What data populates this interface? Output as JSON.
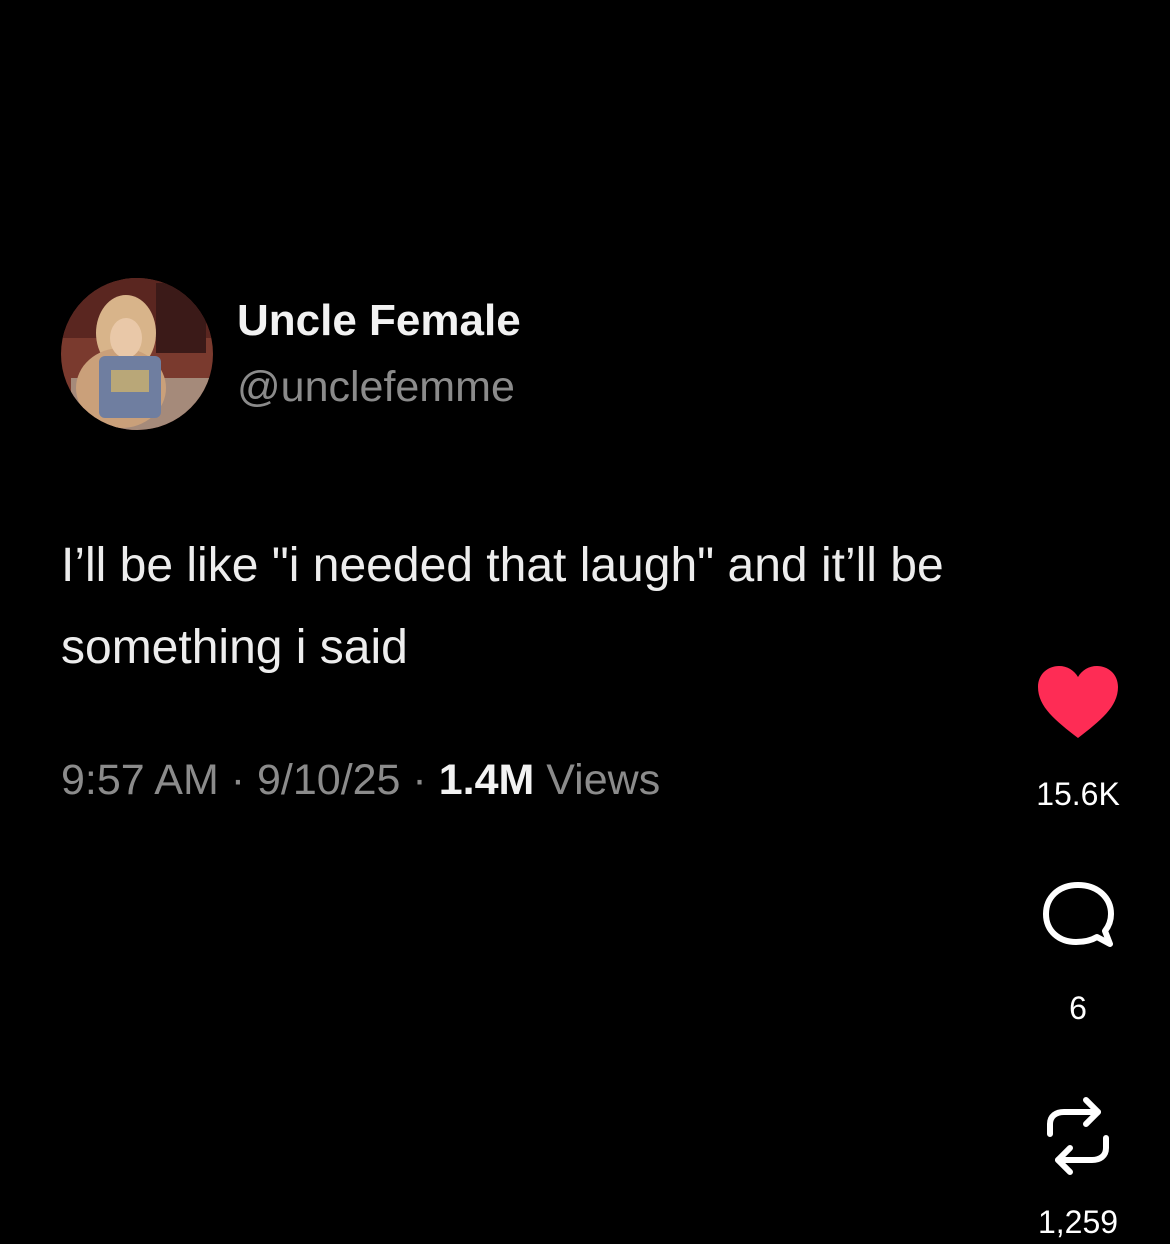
{
  "tweet": {
    "display_name": "Uncle Female",
    "handle": "@unclefemme",
    "text": "I’ll be like \"i needed that laugh\" and it’ll be something i said",
    "time": "9:57 AM",
    "separator": "·",
    "date": "9/10/25",
    "views_count": "1.4M",
    "views_label": "Views"
  },
  "actions": {
    "likes": "15.6K",
    "comments": "6",
    "reposts": "1,259",
    "like_color": "#fe2c55"
  },
  "icons": {
    "like": "heart-icon",
    "comment": "speech-bubble-icon",
    "repost": "repost-icon"
  },
  "colors": {
    "background": "#000000",
    "primary_text": "#ededed",
    "secondary_text": "#8b8b8b"
  }
}
